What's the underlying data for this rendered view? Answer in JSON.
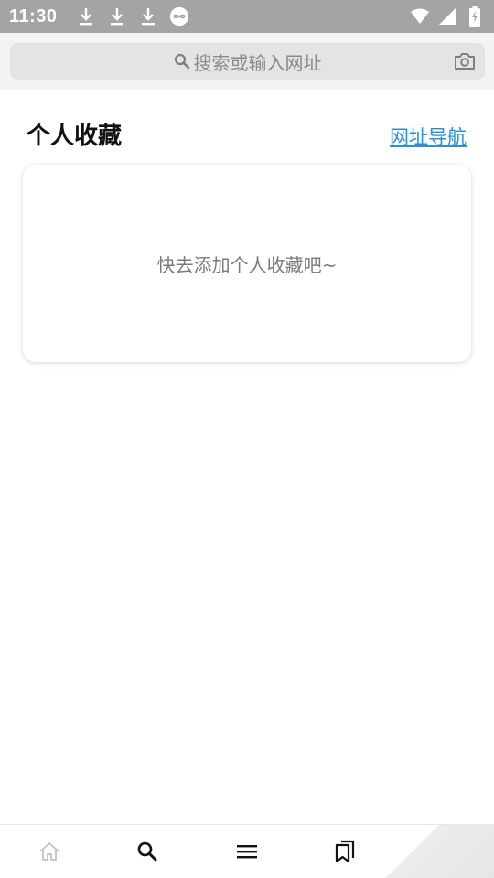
{
  "status_bar": {
    "time": "11:30",
    "left_icons": [
      "download-icon",
      "download-icon",
      "download-icon",
      "infinity-icon"
    ],
    "right_icons": [
      "wifi-icon",
      "signal-icon",
      "battery-icon"
    ]
  },
  "search": {
    "placeholder": "搜索或输入网址"
  },
  "favorites": {
    "title": "个人收藏",
    "nav_link": "网址导航",
    "empty_message": "快去添加个人收藏吧~"
  },
  "bottom_nav": {
    "items": [
      "home-icon",
      "search-icon",
      "menu-icon",
      "bookmarks-icon"
    ],
    "colors": {
      "home": "#c8c8c8",
      "active": "#111111"
    }
  }
}
